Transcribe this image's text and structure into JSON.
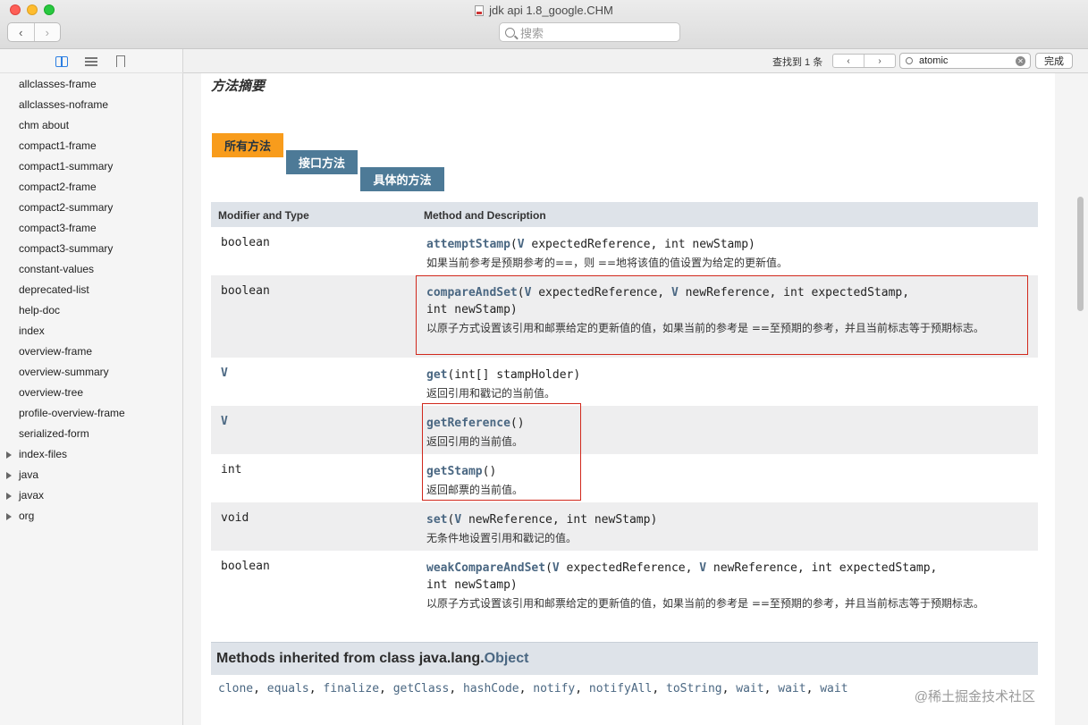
{
  "window": {
    "title": "jdk api 1.8_google.CHM",
    "back_glyph": "‹",
    "forward_glyph": "›",
    "search_placeholder": "搜索"
  },
  "findbar": {
    "count": "查找到 1 条",
    "prev_glyph": "‹",
    "next_glyph": "›",
    "query": "atomic",
    "clear_glyph": "✕",
    "done_label": "完成"
  },
  "sidebar": {
    "items": [
      {
        "label": "allclasses-frame",
        "expandable": false
      },
      {
        "label": "allclasses-noframe",
        "expandable": false
      },
      {
        "label": "chm about",
        "expandable": false
      },
      {
        "label": "compact1-frame",
        "expandable": false
      },
      {
        "label": "compact1-summary",
        "expandable": false
      },
      {
        "label": "compact2-frame",
        "expandable": false
      },
      {
        "label": "compact2-summary",
        "expandable": false
      },
      {
        "label": "compact3-frame",
        "expandable": false
      },
      {
        "label": "compact3-summary",
        "expandable": false
      },
      {
        "label": "constant-values",
        "expandable": false
      },
      {
        "label": "deprecated-list",
        "expandable": false
      },
      {
        "label": "help-doc",
        "expandable": false
      },
      {
        "label": "index",
        "expandable": false
      },
      {
        "label": "overview-frame",
        "expandable": false
      },
      {
        "label": "overview-summary",
        "expandable": false
      },
      {
        "label": "overview-tree",
        "expandable": false
      },
      {
        "label": "profile-overview-frame",
        "expandable": false
      },
      {
        "label": "serialized-form",
        "expandable": false
      },
      {
        "label": "index-files",
        "expandable": true
      },
      {
        "label": "java",
        "expandable": true
      },
      {
        "label": "javax",
        "expandable": true
      },
      {
        "label": "org",
        "expandable": true
      }
    ]
  },
  "summary": {
    "title": "方法摘要",
    "tabs": [
      "所有方法",
      "接口方法",
      "具体的方法"
    ],
    "columns": [
      "Modifier and Type",
      "Method and Description"
    ],
    "rows": [
      {
        "modifier": "boolean",
        "name": "attemptStamp",
        "p1": "(",
        "t1": "V",
        "p2": " expectedReference, int newStamp)",
        "t2": "",
        "p3": "",
        "desc": "如果当前参考是预期参考的==，则 ==地将该值的值设置为给定的更新值。"
      },
      {
        "modifier": "boolean",
        "name": "compareAndSet",
        "p1": "(",
        "t1": "V",
        "p2": " expectedReference, ",
        "t2": "V",
        "p3": " newReference, int expectedStamp,\nint newStamp)",
        "desc": "以原子方式设置该引用和邮票给定的更新值的值，如果当前的参考是 ==至预期的参考，并且当前标志等于预期标志。"
      },
      {
        "modifier": "V",
        "name": "get",
        "p1": "(int[] stampHolder)",
        "t1": "",
        "p2": "",
        "t2": "",
        "p3": "",
        "desc": "返回引用和戳记的当前值。"
      },
      {
        "modifier": "V",
        "name": "getReference",
        "p1": "()",
        "t1": "",
        "p2": "",
        "t2": "",
        "p3": "",
        "desc": "返回引用的当前值。"
      },
      {
        "modifier": "int",
        "name": "getStamp",
        "p1": "()",
        "t1": "",
        "p2": "",
        "t2": "",
        "p3": "",
        "desc": "返回邮票的当前值。"
      },
      {
        "modifier": "void",
        "name": "set",
        "p1": "(",
        "t1": "V",
        "p2": " newReference, int newStamp)",
        "t2": "",
        "p3": "",
        "desc": "无条件地设置引用和戳记的值。"
      },
      {
        "modifier": "boolean",
        "name": "weakCompareAndSet",
        "p1": "(",
        "t1": "V",
        "p2": " expectedReference, ",
        "t2": "V",
        "p3": " newReference, int expectedStamp,\nint newStamp)",
        "desc": "以原子方式设置该引用和邮票给定的更新值的值，如果当前的参考是 ==至预期的参考，并且当前标志等于预期标志。"
      }
    ]
  },
  "inherited": {
    "prefix": "Methods inherited from class java.lang.",
    "class_link": "Object",
    "methods": [
      "clone",
      "equals",
      "finalize",
      "getClass",
      "hashCode",
      "notify",
      "notifyAll",
      "toString",
      "wait",
      "wait",
      "wait"
    ]
  },
  "watermark": "@稀土掘金技术社区",
  "colors": {
    "accent_tab": "#f89c1c",
    "tab": "#4d7a97",
    "link": "#4a6782",
    "highlight_box": "#d1281c"
  }
}
